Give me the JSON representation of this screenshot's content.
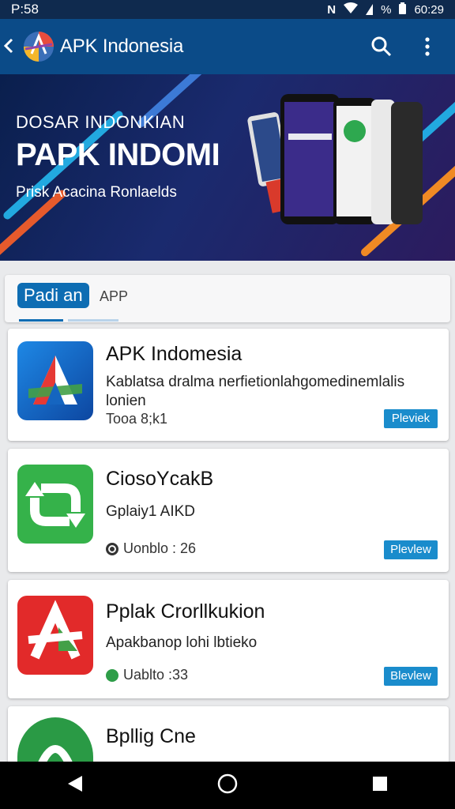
{
  "status": {
    "time": "P:58",
    "battery": "%",
    "clock": "60:29"
  },
  "app_bar": {
    "title": "APK Indonesia"
  },
  "banner": {
    "subtitle": "DOSAR INDONKIAN",
    "title": "PAPK INDOMI",
    "caption": "Prisk Acacina Ronlaelds"
  },
  "tabs": {
    "active": "Padi an",
    "other": "APP"
  },
  "cards": [
    {
      "title": "APK Indomesia",
      "desc": "Kablatsa dralma nerfietionlahgomedinemlalis lonien",
      "meta": "Tooa 8;k1",
      "button": "Pleviek"
    },
    {
      "title": "CiosoYcakB",
      "desc": "Gplaiy1 AIKD",
      "meta": "Uonblo : 26",
      "button": "Plevlew"
    },
    {
      "title": "Pplak Crorllkukion",
      "desc": "Apakbanop lohi lbtieko",
      "meta": "Uablto :33",
      "button": "Blevlew"
    },
    {
      "title": "Bpllig Cne",
      "desc": "",
      "meta": "",
      "button": ""
    }
  ],
  "colors": {
    "app_bar": "#0b4b88",
    "accent": "#1a8ccc",
    "status_bar": "#0f2a4e"
  }
}
